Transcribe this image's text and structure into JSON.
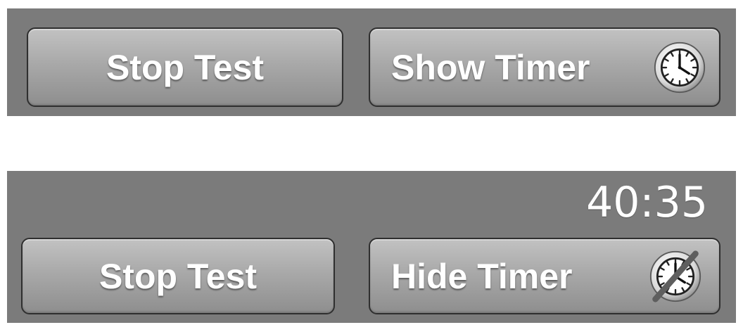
{
  "top_panel": {
    "stop_button_label": "Stop Test",
    "timer_button_label": "Show Timer",
    "timer_button_icon": "clock-icon"
  },
  "bottom_panel": {
    "timer_readout": "40:35",
    "stop_button_label": "Stop Test",
    "timer_button_label": "Hide Timer",
    "timer_button_icon": "clock-crossed-out-icon"
  },
  "colors": {
    "panel_background": "#7b7b7b",
    "button_text": "#ffffff",
    "button_border": "#2f2f2f"
  }
}
